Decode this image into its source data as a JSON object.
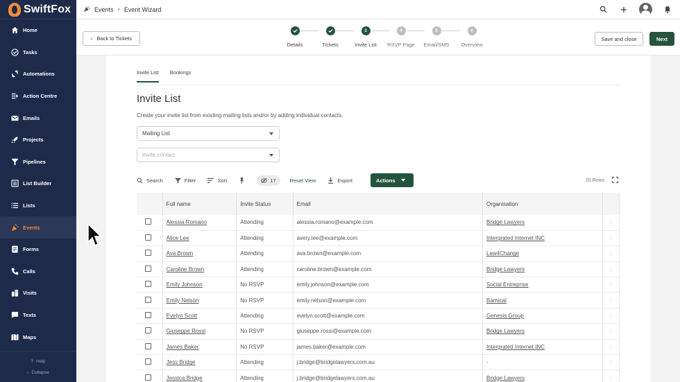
{
  "app": {
    "name": "SwiftFox"
  },
  "colors": {
    "brand": "#1e2a4a",
    "accent": "#f08a3a",
    "primary": "#24543b"
  },
  "sidebar": {
    "items": [
      {
        "label": "Home",
        "icon": "home-icon"
      },
      {
        "label": "Tasks",
        "icon": "check-circle-icon"
      },
      {
        "label": "Automations",
        "icon": "sync-icon"
      },
      {
        "label": "Action Centre",
        "icon": "list-arrow-icon"
      },
      {
        "label": "Emails",
        "icon": "mail-icon"
      },
      {
        "label": "Projects",
        "icon": "rocket-icon"
      },
      {
        "label": "Pipelines",
        "icon": "funnel-icon"
      },
      {
        "label": "List Builder",
        "icon": "list-builder-icon"
      },
      {
        "label": "Lists",
        "icon": "lines-icon"
      },
      {
        "label": "Events",
        "icon": "party-icon",
        "active": true
      },
      {
        "label": "Forms",
        "icon": "form-icon"
      },
      {
        "label": "Calls",
        "icon": "phone-icon"
      },
      {
        "label": "Visits",
        "icon": "buildings-icon"
      },
      {
        "label": "Texts",
        "icon": "chat-icon"
      },
      {
        "label": "Maps",
        "icon": "map-icon"
      }
    ],
    "help": "Help",
    "collapse": "Collapse"
  },
  "header": {
    "breadcrumb": [
      "Events",
      "Event Wizard"
    ]
  },
  "wizard": {
    "back": "Back to Tickets",
    "save": "Save and close",
    "next": "Next",
    "steps": [
      {
        "label": "Details",
        "state": "done",
        "num": ""
      },
      {
        "label": "Tickets",
        "state": "done",
        "num": ""
      },
      {
        "label": "Invite List",
        "state": "current",
        "num": "3"
      },
      {
        "label": "RSVP Page",
        "state": "todo",
        "num": "4"
      },
      {
        "label": "Email/SMS",
        "state": "todo",
        "num": "5"
      },
      {
        "label": "Overview",
        "state": "todo",
        "num": "6"
      }
    ]
  },
  "main": {
    "tabs": [
      "Invite List",
      "Bookings"
    ],
    "title": "Invite List",
    "description": "Create your invite list from existing mailing lists and/or by adding individual contacts.",
    "mailing_list": "Mailing List",
    "invite_placeholder": "Invite contact",
    "toolbar": {
      "search": "Search",
      "filter": "Filter",
      "sort": "Sort",
      "hidden_count": "17",
      "reset": "Reset View",
      "export": "Export",
      "actions": "Actions",
      "rows": "20 Rows"
    },
    "table": {
      "headers": [
        "Full name",
        "Invite Status",
        "Email",
        "Organisation"
      ],
      "rows": [
        [
          "Alessia Romano",
          "Attending",
          "alessia.romano@example.com",
          "Bridge Lawyers"
        ],
        [
          "Alice Lee",
          "Attending",
          "avery.lee@example.com",
          "Intergrated Internet INC"
        ],
        [
          "Ava Brown",
          "Attending",
          "ava.brown@example.com",
          "Law4Change"
        ],
        [
          "Caroline Brown",
          "Attending",
          "caroline.brown@example.com",
          "Bridge Lawyers"
        ],
        [
          "Emily Johnson",
          "No RSVP",
          "emily.johnson@example.com",
          "Social Entreprise"
        ],
        [
          "Emily Nelson",
          "No RSVP",
          "emily.nelson@example.com",
          "Barnical"
        ],
        [
          "Evelyn Scott",
          "Attending",
          "evelyn.scott@example.com",
          "Genesis Group"
        ],
        [
          "Giuseppe Rossi",
          "No RSVP",
          "giuseppe.rossi@example.com",
          "Bridge Lawyers"
        ],
        [
          "James Baker",
          "No RSVP",
          "james.baker@example.com",
          "Intergrated Internet INC"
        ],
        [
          "Jess Bridge",
          "Attending",
          "j.bridge@bridgelawyers.com.au",
          "-"
        ],
        [
          "Jessica Bridge",
          "Attending",
          "j.bridge@bridgelawyers.com.au",
          "Bridge Lawyers"
        ]
      ]
    }
  }
}
